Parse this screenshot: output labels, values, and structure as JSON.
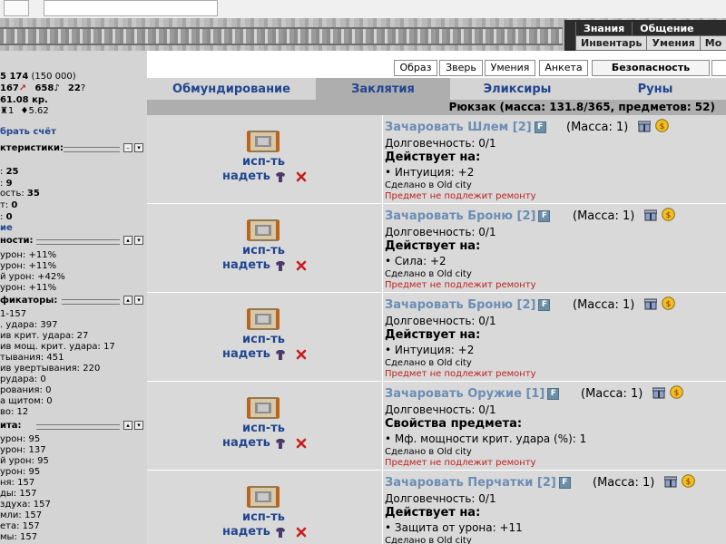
{
  "topnav": {
    "row1": [
      "Знания",
      "Общение"
    ],
    "row2": [
      "Инвентарь",
      "Умения",
      "Мо"
    ]
  },
  "left": {
    "stats_line1": "5 174",
    "stats_line1_b": "(150 000)",
    "stats_line2_a": "167",
    "stats_line2_b": "658",
    "stats_line2_c": "22",
    "money": "61.08 кр.",
    "line4_a": "1",
    "line4_b": "5.62",
    "collect": "брать счёт",
    "section_chars": "ктеристики:",
    "chars": [
      {
        "label": ":",
        "value": "25"
      },
      {
        "label": ":",
        "value": "9"
      },
      {
        "label": "ость:",
        "value": "35"
      },
      {
        "label": "т:",
        "value": "0"
      },
      {
        "label": ":",
        "value": "0"
      }
    ],
    "more": "ие",
    "section_skills": "ности:",
    "skills": [
      "урон: +11%",
      "урон: +11%",
      "й урон: +42%",
      "урон: +11%"
    ],
    "section_mods": "фикаторы:",
    "mods": [
      "1-157",
      ". удара: 397",
      "ив крит. удара: 27",
      "ив мощ. крит. удара: 17",
      "тывания: 451",
      "ив увертывания: 220",
      "рудара: 0",
      "рования: 0",
      "а щитом: 0",
      "во: 12"
    ],
    "section_armor": "ита:",
    "armor": [
      "урон: 95",
      "урон: 137",
      "й урон: 95",
      "урон: 95",
      "ня: 157",
      "ды: 157",
      "здуха: 157",
      "мли: 157",
      "ета: 157",
      "мы: 157"
    ]
  },
  "buttons": [
    "Образ",
    "Зверь",
    "Умения",
    "Анкета",
    "Безопасность"
  ],
  "tabs": [
    "Обмундирование",
    "Заклятия",
    "Эликсиры",
    "Руны"
  ],
  "bag": "Рюкзак (масса: 131.8/365, предметов: 52)",
  "actions": {
    "use": "исп-ть",
    "wear": "надеть"
  },
  "items": [
    {
      "name": "Зачаровать Шлем [2]",
      "flag": "F",
      "mass": "(Масса: 1)",
      "durability": "Долговечность: 0/1",
      "effect_title": "Действует на:",
      "effect": "• Интуиция: +2",
      "made": "Сделано в Old city",
      "repair": "Предмет не подлежит ремонту"
    },
    {
      "name": "Зачаровать Броню [2]",
      "flag": "F",
      "mass": "(Масса: 1)",
      "durability": "Долговечность: 0/1",
      "effect_title": "Действует на:",
      "effect": "• Сила: +2",
      "made": "Сделано в Old city",
      "repair": "Предмет не подлежит ремонту"
    },
    {
      "name": "Зачаровать Броню [2]",
      "flag": "F",
      "mass": "(Масса: 1)",
      "durability": "Долговечность: 0/1",
      "effect_title": "Действует на:",
      "effect": "• Интуиция: +2",
      "made": "Сделано в Old city",
      "repair": "Предмет не подлежит ремонту"
    },
    {
      "name": "Зачаровать Оружие [1]",
      "flag": "F",
      "mass": "(Масса: 1)",
      "durability": "Долговечность: 0/1",
      "effect_title": "Свойства предмета:",
      "effect": "• Мф. мощности крит. удара (%): 1",
      "made": "Сделано в Old city",
      "repair": "Предмет не подлежит ремонту"
    },
    {
      "name": "Зачаровать Перчатки [2]",
      "flag": "F",
      "mass": "(Масса: 1)",
      "durability": "Долговечность: 0/1",
      "effect_title": "Действует на:",
      "effect": "• Защита от урона: +11",
      "made": "Сделано в Old city",
      "repair": ""
    }
  ]
}
